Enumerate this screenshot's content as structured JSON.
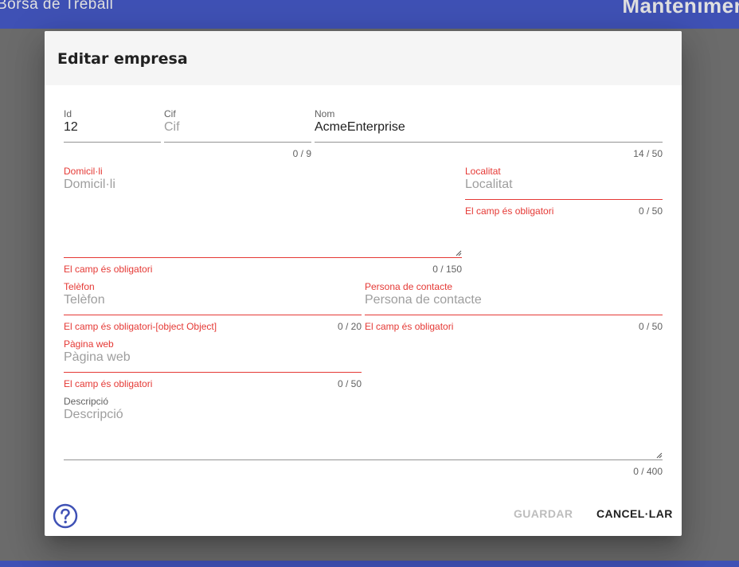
{
  "appbar": {
    "left_title": "Borsa de Treball",
    "right_title": "Mantenimen"
  },
  "dialog": {
    "title": "Editar empresa",
    "fields": {
      "id": {
        "label": "Id",
        "value": "12"
      },
      "cif": {
        "label": "Cif",
        "placeholder": "Cif",
        "counter": "0 / 9"
      },
      "nom": {
        "label": "Nom",
        "value": "AcmeEnterprise",
        "counter": "14 / 50"
      },
      "domicili": {
        "label": "Domicil·li",
        "placeholder": "Domicil·li",
        "error": "El camp és obligatori",
        "counter": "0 / 150"
      },
      "localitat": {
        "label": "Localitat",
        "placeholder": "Localitat",
        "error": "El camp és obligatori",
        "counter": "0 / 50"
      },
      "telefon": {
        "label": "Telèfon",
        "placeholder": "Telèfon",
        "error": "El camp és obligatori-[object Object]",
        "counter": "0 / 20"
      },
      "persona_contacte": {
        "label": "Persona de contacte",
        "placeholder": "Persona de contacte",
        "error": "El camp és obligatori",
        "counter": "0 / 50"
      },
      "pagina_web": {
        "label": "Pàgina web",
        "placeholder": "Pàgina web",
        "error": "El camp és obligatori",
        "counter": "0 / 50"
      },
      "descripcio": {
        "label": "Descripció",
        "placeholder": "Descripció",
        "counter": "0 / 400"
      }
    },
    "buttons": {
      "save": "GUARDAR",
      "cancel": "CANCEL·LAR"
    },
    "help_icon": "help-circle-icon",
    "colors": {
      "primary": "#3f51b5",
      "error": "#e53935"
    }
  }
}
